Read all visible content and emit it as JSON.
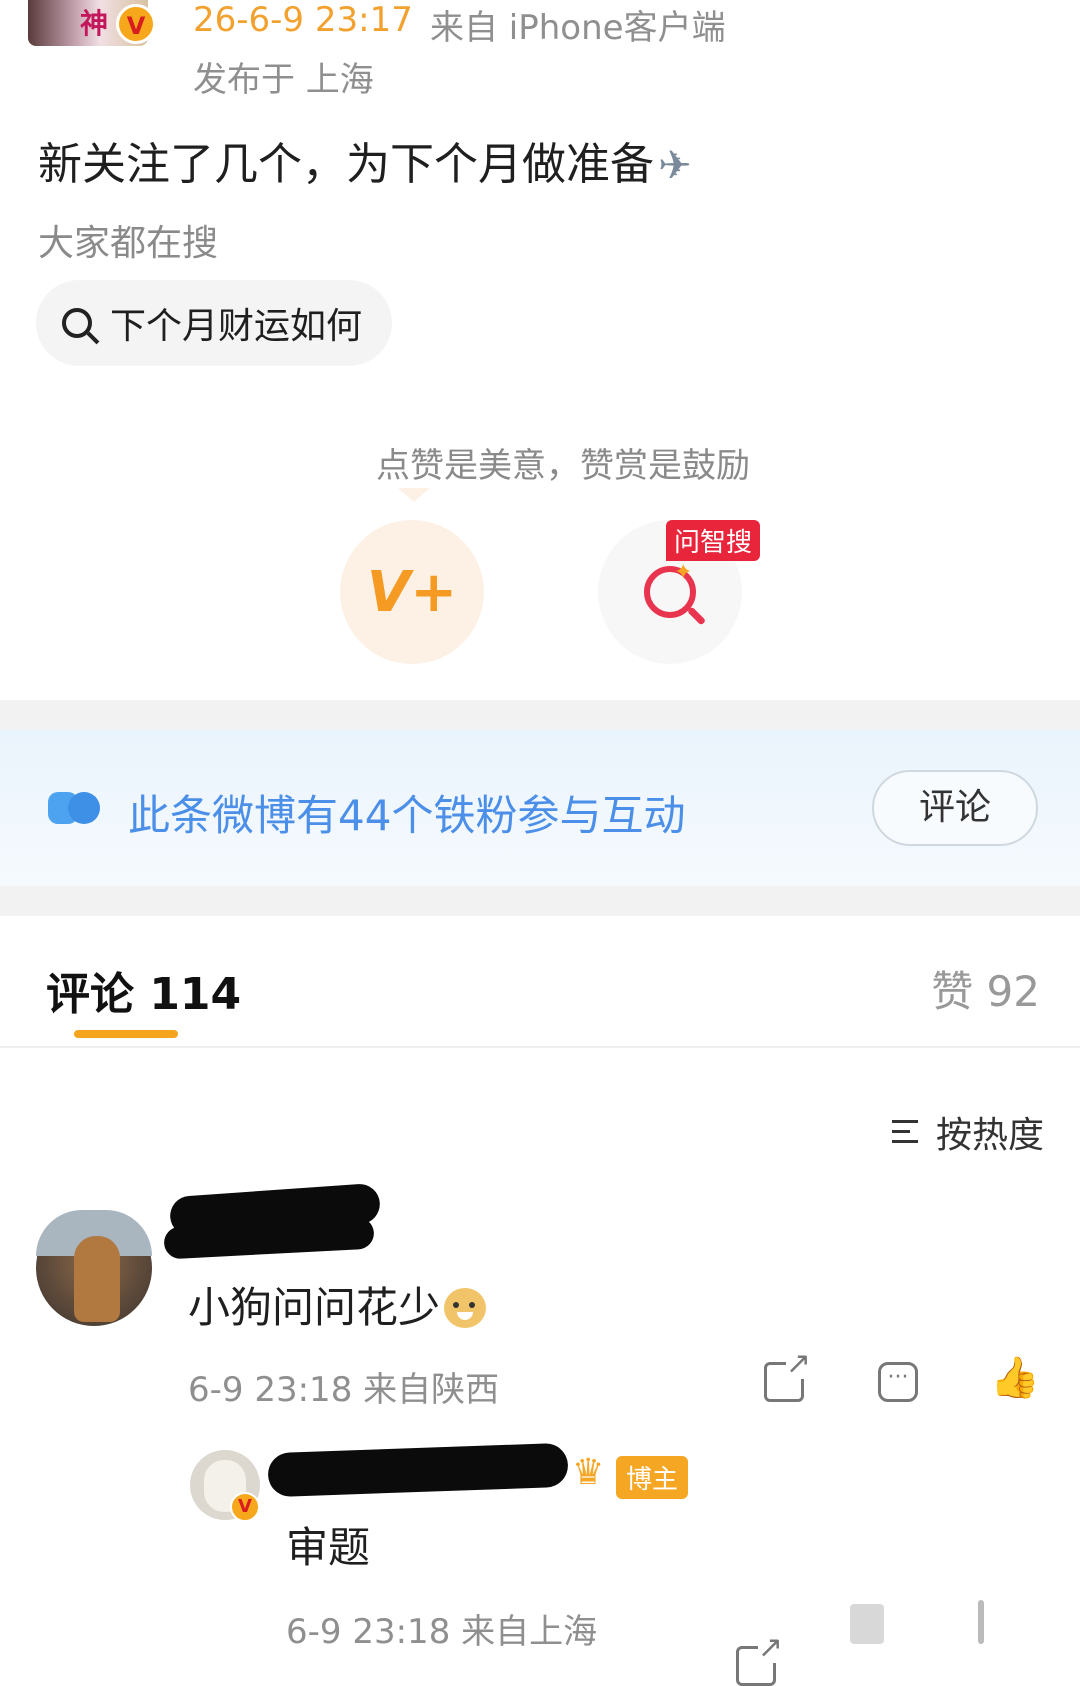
{
  "post": {
    "time": "26-6-9 23:17",
    "source": "来自 iPhone客户端",
    "location": "发布于 上海",
    "text": "新关注了几个，为下个月做准备",
    "avatar_text": "神"
  },
  "hot_search": {
    "title": "大家都在搜",
    "query": "下个月财运如何"
  },
  "reward": {
    "hint": "点赞是美意，赞赏是鼓励",
    "vplus_label": "V+",
    "search_badge": "问智搜"
  },
  "fans": {
    "text": "此条微博有44个铁粉参与互动",
    "button": "评论"
  },
  "tabs": {
    "comments": "评论 114",
    "likes": "赞 92"
  },
  "sort": {
    "label": "按热度"
  },
  "comments": [
    {
      "text": "小狗问问花少",
      "meta": "6-9 23:18 来自陕西"
    }
  ],
  "reply": {
    "badge": "博主",
    "text": "审题",
    "meta": "6-9 23:18 来自上海"
  },
  "colors": {
    "accent_orange": "#f5a41d",
    "link_blue": "#4b8fe8",
    "alert_red": "#e8253a"
  },
  "icons": [
    "search-icon",
    "plane-icon",
    "vplus-icon",
    "ai-search-icon",
    "fan-icon",
    "sort-icon",
    "share-icon",
    "comment-icon",
    "like-icon",
    "crown-icon",
    "dog-emoji-icon",
    "verified-icon"
  ]
}
